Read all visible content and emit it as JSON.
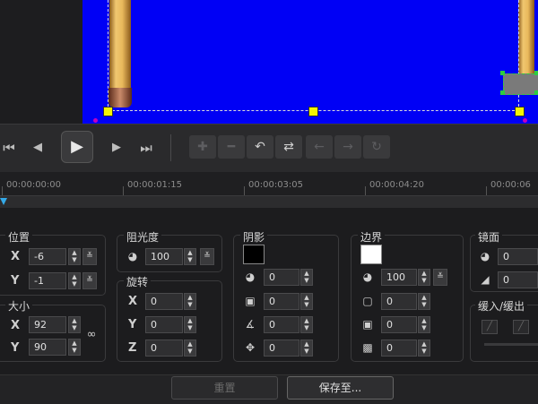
{
  "playback": {
    "to_start_icon": "⏮",
    "prev_frame_icon": "◀",
    "play_icon": "▶",
    "next_frame_icon": "▶",
    "to_end_icon": "⏭"
  },
  "timeline": {
    "timecodes": [
      "00:00:00:00",
      "00:00:01:15",
      "00:00:03:05",
      "00:00:04:20",
      "00:00:06"
    ]
  },
  "position": {
    "label": "位置",
    "x_label": "X",
    "x_value": "-6",
    "y_label": "Y",
    "y_value": "-1"
  },
  "size": {
    "label": "大小",
    "x_label": "X",
    "x_value": "92",
    "y_label": "Y",
    "y_value": "90"
  },
  "opacity": {
    "label": "阻光度",
    "value": "100"
  },
  "rotation": {
    "label": "旋转",
    "x_label": "X",
    "x_value": "0",
    "y_label": "Y",
    "y_value": "0",
    "z_label": "Z",
    "z_value": "0"
  },
  "shadow": {
    "label": "阴影",
    "color": "#000000",
    "values": [
      "0",
      "0",
      "0",
      "0"
    ]
  },
  "border": {
    "label": "边界",
    "color": "#ffffff",
    "values": [
      "100",
      "0",
      "0",
      "0"
    ]
  },
  "mirror": {
    "label": "镜面",
    "values": [
      "0",
      "0"
    ]
  },
  "fade": {
    "label": "缓入/缓出"
  },
  "buttons": {
    "reset": "重置",
    "save_to": "保存至..."
  },
  "colors": {
    "canvas": "#0000f5",
    "handle": "#f5f500",
    "playhead": "#34a9e8"
  }
}
